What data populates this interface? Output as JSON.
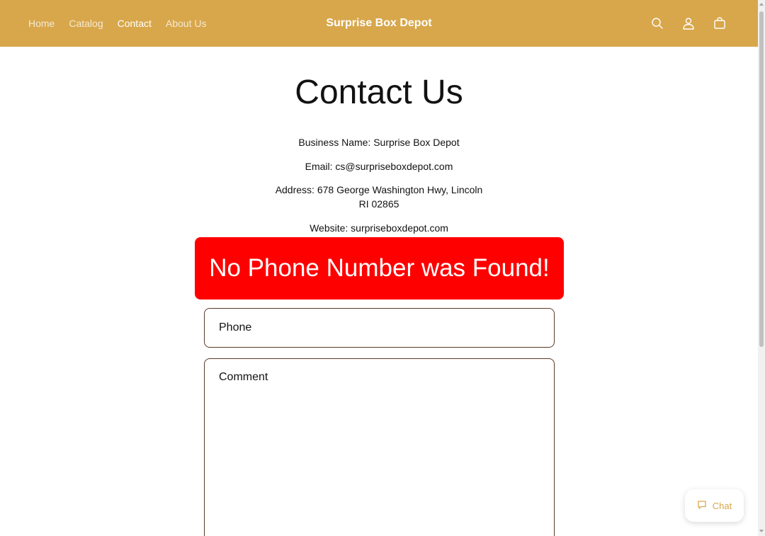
{
  "header": {
    "nav": [
      "Home",
      "Catalog",
      "Contact",
      "About Us"
    ],
    "active_nav": "Contact",
    "brand": "Surprise Box Depot",
    "icons": [
      "search-icon",
      "account-icon",
      "cart-icon"
    ]
  },
  "main": {
    "title": "Contact Us",
    "business_name": "Business Name: Surprise Box Depot",
    "email": "Email: cs@surpriseboxdepot.com",
    "address_line1": "Address: 678 George Washington Hwy, Lincoln",
    "address_line2": "RI 02865",
    "website": "Website: surpriseboxdepot.com",
    "alert": "No Phone Number was Found!"
  },
  "form": {
    "phone_placeholder": "Phone",
    "phone_value": "",
    "comment_placeholder": "Comment",
    "comment_value": ""
  },
  "chat": {
    "label": "Chat",
    "icon": "chat-bubble-icon"
  },
  "colors": {
    "header_bg": "#d8a74b",
    "alert_bg": "#ff0000",
    "accent": "#d8a74b"
  }
}
